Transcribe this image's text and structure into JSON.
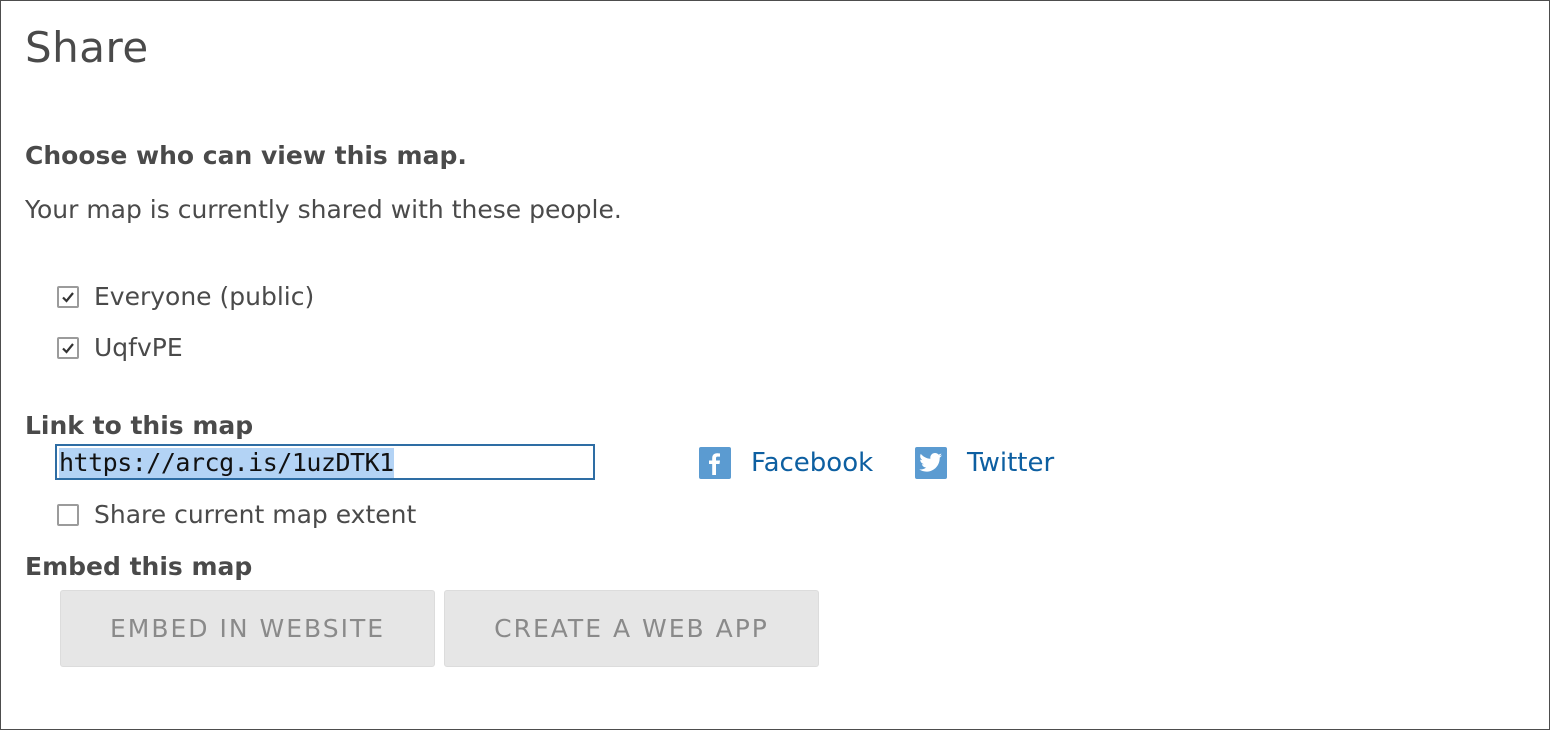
{
  "dialog": {
    "title": "Share"
  },
  "visibility": {
    "heading": "Choose who can view this map.",
    "description": "Your map is currently shared with these people.",
    "options": [
      {
        "label": "Everyone (public)",
        "checked": true
      },
      {
        "label": "UqfvPE",
        "checked": true
      }
    ]
  },
  "link": {
    "heading": "Link to this map",
    "url": "https://arcg.is/1uzDTK1",
    "extent_label": "Share current map extent",
    "extent_checked": false,
    "social": [
      {
        "label": "Facebook",
        "icon": "facebook-icon"
      },
      {
        "label": "Twitter",
        "icon": "twitter-icon"
      }
    ]
  },
  "embed": {
    "heading": "Embed this map",
    "buttons": [
      {
        "label": "EMBED IN WEBSITE"
      },
      {
        "label": "CREATE A WEB APP"
      }
    ]
  },
  "colors": {
    "link": "#0d5fa1",
    "icon_bg": "#5b9bd1",
    "selection": "#b3d3f5",
    "input_border": "#2e6da4"
  }
}
